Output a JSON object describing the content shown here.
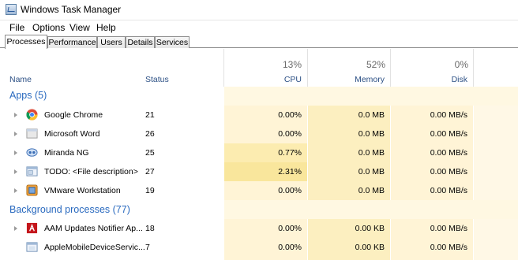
{
  "window": {
    "title": "Windows Task Manager"
  },
  "menu": [
    "File",
    "Options",
    "View",
    "Help"
  ],
  "tabs": [
    "Processes",
    "Performance",
    "Users",
    "Details",
    "Services"
  ],
  "columns": {
    "name": "Name",
    "status": "Status",
    "cpu": {
      "label": "CPU",
      "total": "13%"
    },
    "memory": {
      "label": "Memory",
      "total": "52%"
    },
    "disk": {
      "label": "Disk",
      "total": "0%"
    }
  },
  "groups": [
    {
      "label": "Apps (5)",
      "processes": [
        {
          "name": "Google Chrome",
          "status": "21",
          "cpu": "0.00%",
          "memory": "0.0 MB",
          "disk": "0.00 MB/s",
          "icon": "chrome-icon"
        },
        {
          "name": "Microsoft Word",
          "status": "26",
          "cpu": "0.00%",
          "memory": "0.0 MB",
          "disk": "0.00 MB/s",
          "icon": "word-icon"
        },
        {
          "name": "Miranda NG",
          "status": "25",
          "cpu": "0.77%",
          "memory": "0.0 MB",
          "disk": "0.00 MB/s",
          "icon": "miranda-icon"
        },
        {
          "name": "TODO: <File description>",
          "status": "27",
          "cpu": "2.31%",
          "memory": "0.0 MB",
          "disk": "0.00 MB/s",
          "icon": "app-window-icon"
        },
        {
          "name": "VMware Workstation",
          "status": "19",
          "cpu": "0.00%",
          "memory": "0.0 MB",
          "disk": "0.00 MB/s",
          "icon": "vmware-icon"
        }
      ]
    },
    {
      "label": "Background processes (77)",
      "processes": [
        {
          "name": "AAM Updates Notifier Ap...",
          "status": "18",
          "cpu": "0.00%",
          "memory": "0.00 KB",
          "disk": "0.00 MB/s",
          "icon": "adobe-icon"
        },
        {
          "name": "AppleMobileDeviceServic...",
          "status": "7",
          "cpu": "0.00%",
          "memory": "0.00 KB",
          "disk": "0.00 MB/s",
          "icon": "apple-service-icon"
        }
      ]
    }
  ],
  "colors": {
    "header_text": "#2b4f84",
    "group_text": "#2a6abf",
    "cell_light": "#fff4d6",
    "cell_mid": "#fcefc0",
    "cell_strong": "#f9e69c"
  }
}
